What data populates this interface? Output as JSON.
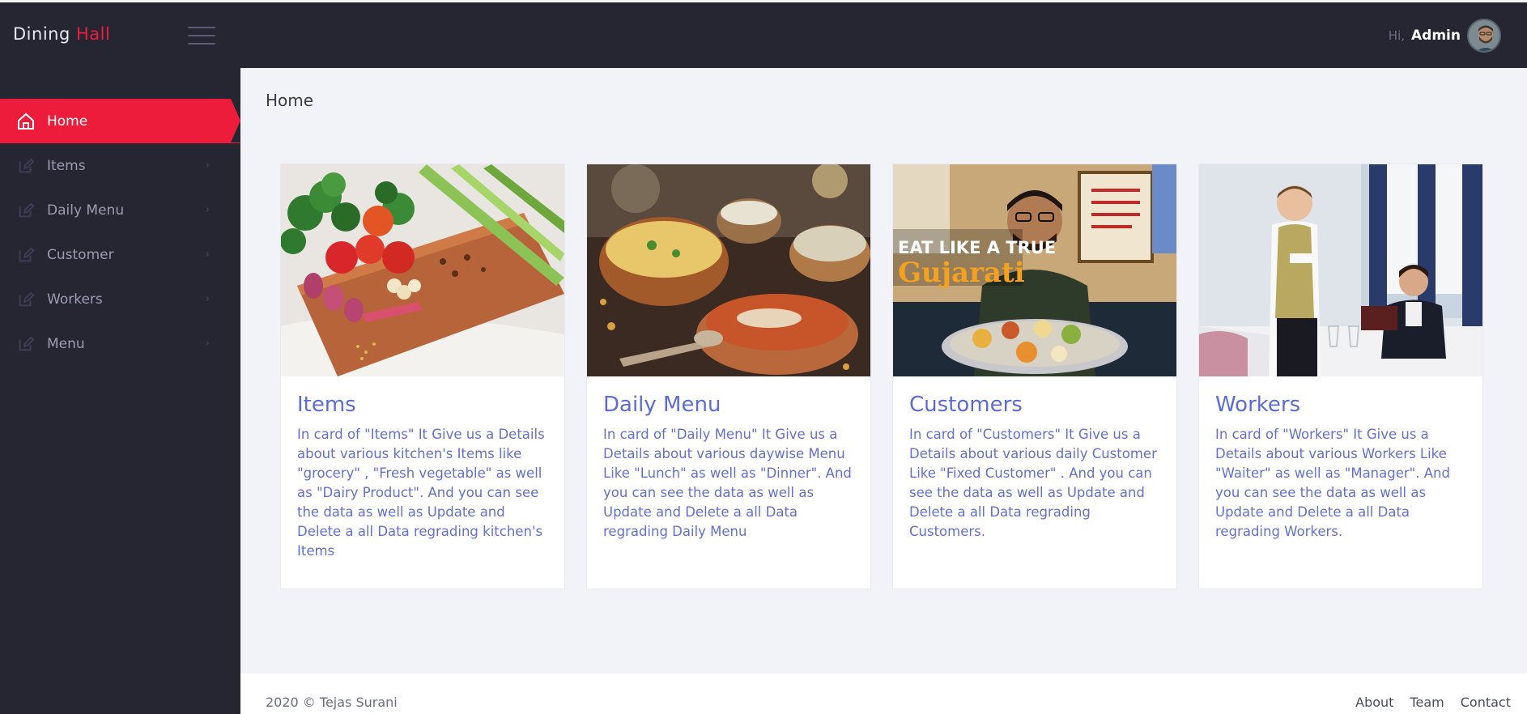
{
  "brand": {
    "part1": "Dining ",
    "part2": "Hall"
  },
  "header": {
    "greeting": "Hi,",
    "username": "Admin"
  },
  "sidebar": {
    "items": [
      {
        "label": "Home",
        "icon": "home-icon",
        "active": true
      },
      {
        "label": "Items",
        "icon": "edit-icon",
        "chevron": "›"
      },
      {
        "label": "Daily Menu",
        "icon": "edit-icon",
        "chevron": "›"
      },
      {
        "label": "Customer",
        "icon": "edit-icon",
        "chevron": "›"
      },
      {
        "label": "Workers",
        "icon": "edit-icon",
        "chevron": "›"
      },
      {
        "label": "Menu",
        "icon": "edit-icon",
        "chevron": "›"
      }
    ]
  },
  "main": {
    "title": "Home",
    "cards": [
      {
        "title": "Items",
        "text": "In card of \"Items\" It Give us a Details about various kitchen's Items like \"grocery\" , \"Fresh vegetable\" as well as \"Dairy Product\". And you can see the data as well as Update and Delete a all Data regrading kitchen's Items"
      },
      {
        "title": "Daily Menu",
        "text": "In card of \"Daily Menu\" It Give us a Details about various daywise Menu Like \"Lunch\" as well as \"Dinner\". And you can see the data as well as Update and Delete a all Data regrading Daily Menu"
      },
      {
        "title": "Customers",
        "text": "In card of \"Customers\" It Give us a Details about various daily Customer Like \"Fixed Customer\" . And you can see the data as well as Update and Delete a all Data regrading Customers.",
        "image_overlay": {
          "line1": "EAT LIKE A TRUE",
          "line2": "Gujarati"
        }
      },
      {
        "title": "Workers",
        "text": "In card of \"Workers\" It Give us a Details about various Workers Like \"Waiter\" as well as \"Manager\". And you can see the data as well as Update and Delete a all Data regrading Workers."
      }
    ]
  },
  "footer": {
    "copyright": "2020 © Tejas Surani",
    "links": [
      "About",
      "Team",
      "Contact"
    ]
  },
  "colors": {
    "accent": "#ed1c3a",
    "sidebar_bg": "#262633",
    "card_title": "#5b6cd6",
    "card_text": "#6270d0"
  }
}
